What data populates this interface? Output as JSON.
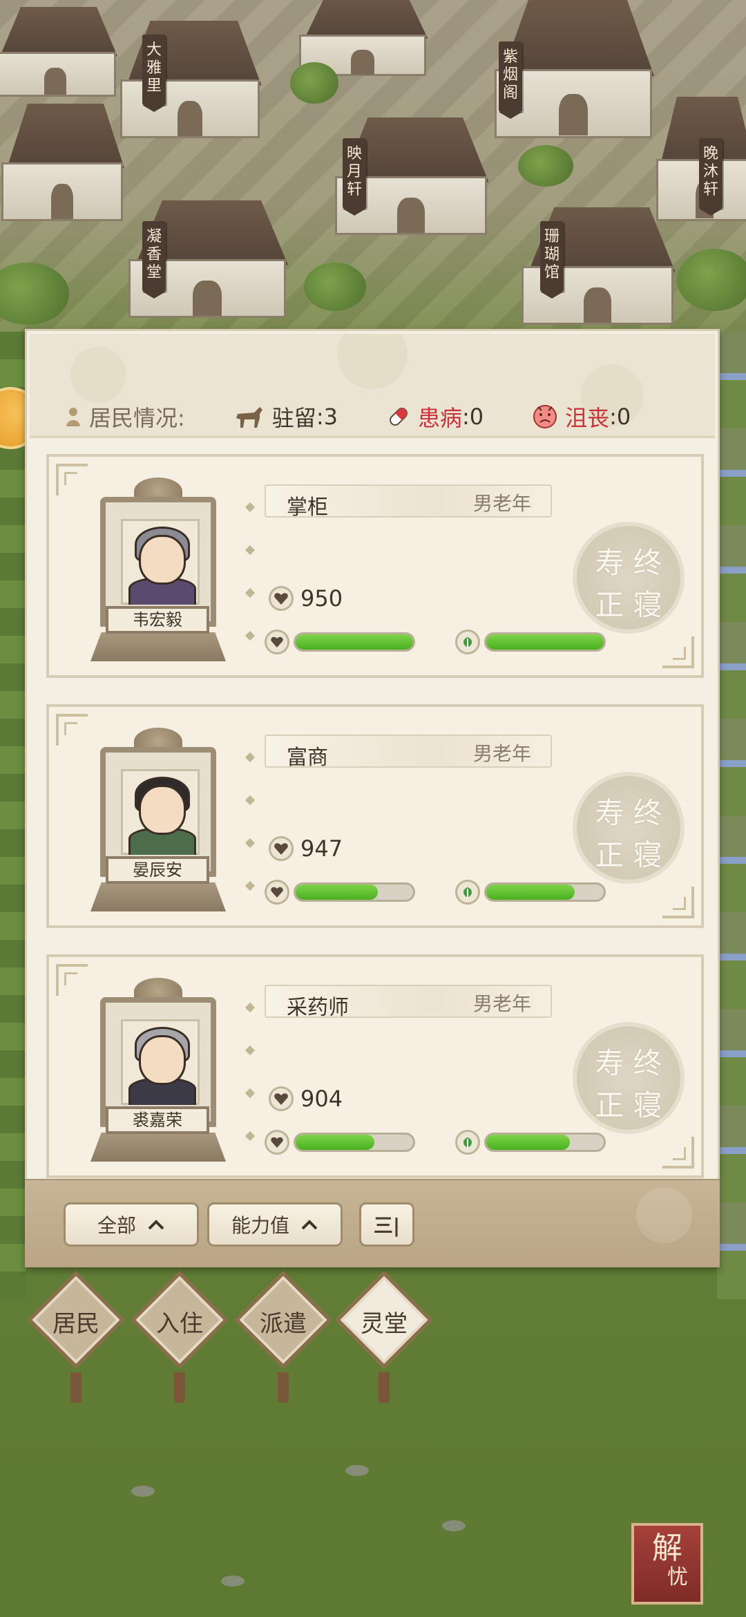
{
  "town": {
    "signs": [
      "大雅里",
      "紫烟阁",
      "映月轩",
      "晚沐轩",
      "凝香堂",
      "珊瑚馆"
    ]
  },
  "summary": {
    "residents_label": "居民情况:",
    "stay_label": "驻留",
    "stay_value": ":3",
    "sick_label": "患病",
    "sick_value": ":0",
    "sad_label": "沮丧",
    "sad_value": ":0"
  },
  "residents": [
    {
      "name": "韦宏毅",
      "role": "掌柜",
      "meta": "男老年",
      "ability": "950",
      "health": 1.0,
      "mood": 1.0,
      "stamp": [
        "寿",
        "终",
        "正",
        "寝"
      ]
    },
    {
      "name": "晏辰安",
      "role": "富商",
      "meta": "男老年",
      "ability": "947",
      "health": 0.7,
      "mood": 0.75,
      "stamp": [
        "寿",
        "终",
        "正",
        "寝"
      ]
    },
    {
      "name": "裘嘉荣",
      "role": "采药师",
      "meta": "男老年",
      "ability": "904",
      "health": 0.67,
      "mood": 0.71,
      "stamp": [
        "寿",
        "终",
        "正",
        "寝"
      ]
    }
  ],
  "filters": {
    "all_label": "全部",
    "ability_label": "能力值",
    "sort_label": "三|"
  },
  "tabs": [
    {
      "label": "居民",
      "active": false
    },
    {
      "label": "入住",
      "active": false
    },
    {
      "label": "派遣",
      "active": false
    },
    {
      "label": "灵堂",
      "active": true
    }
  ],
  "jieyou": {
    "big": "解",
    "small": "忧"
  },
  "colors": {
    "health_bar": "#49b01f",
    "warning_red": "#c9313b",
    "panel_bg": "#f4efe3"
  }
}
